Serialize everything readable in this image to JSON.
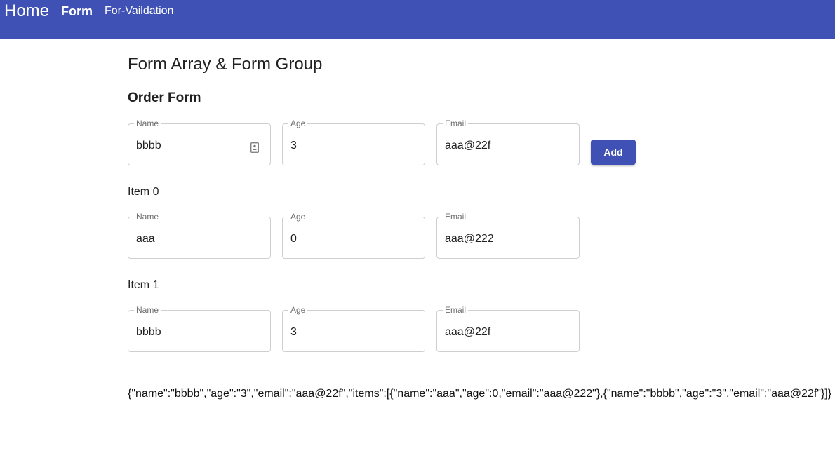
{
  "nav": {
    "home": "Home",
    "form": "Form",
    "validation": "For-Vaildation"
  },
  "colors": {
    "primary": "#3f51b5",
    "on_primary": "#ffffff"
  },
  "page_title": "Form Array & Form Group",
  "section_title": "Order Form",
  "main_form": {
    "name": {
      "label": "Name",
      "value": "bbbb",
      "icon": "contact-card-icon"
    },
    "age": {
      "label": "Age",
      "value": "3"
    },
    "email": {
      "label": "Email",
      "value": "aaa@22f"
    },
    "add_label": "Add"
  },
  "items": [
    {
      "title": "Item 0",
      "name": {
        "label": "Name",
        "value": "aaa"
      },
      "age": {
        "label": "Age",
        "value": "0"
      },
      "email": {
        "label": "Email",
        "value": "aaa@222"
      }
    },
    {
      "title": "Item 1",
      "name": {
        "label": "Name",
        "value": "bbbb"
      },
      "age": {
        "label": "Age",
        "value": "3"
      },
      "email": {
        "label": "Email",
        "value": "aaa@22f"
      }
    }
  ],
  "json_output": "{\"name\":\"bbbb\",\"age\":\"3\",\"email\":\"aaa@22f\",\"items\":[{\"name\":\"aaa\",\"age\":0,\"email\":\"aaa@222\"},{\"name\":\"bbbb\",\"age\":\"3\",\"email\":\"aaa@22f\"}]}"
}
